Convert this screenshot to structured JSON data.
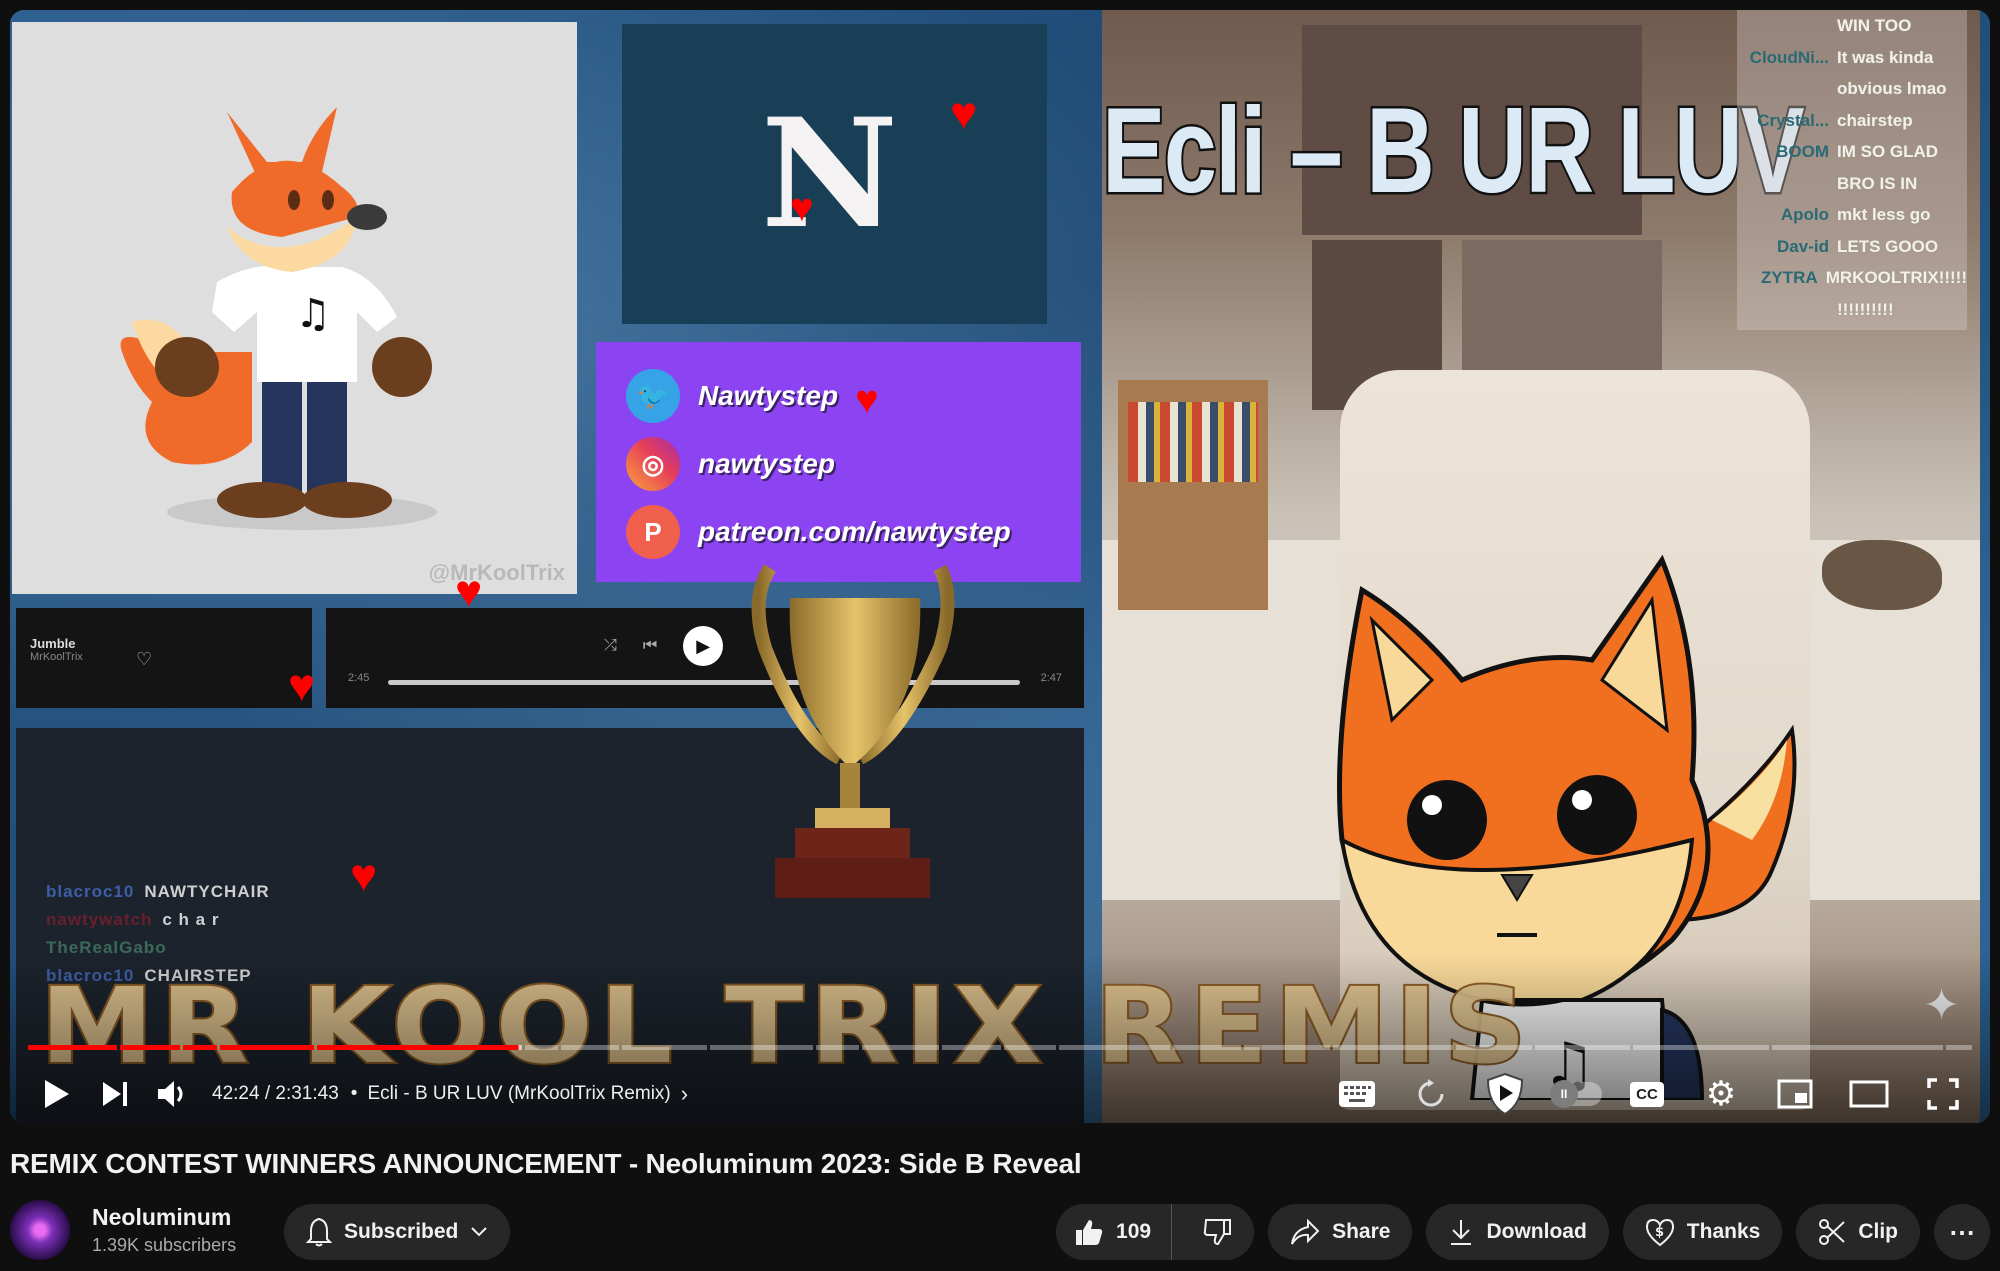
{
  "video_frame": {
    "fox_watermark": "@MrKoolTrix",
    "logo_letter": "N",
    "socials": [
      {
        "icon": "twitter-icon",
        "text": "Nawtystep"
      },
      {
        "icon": "instagram-icon",
        "text": "nawtystep"
      },
      {
        "icon": "patreon-icon",
        "text": "patreon.com/nawtystep"
      }
    ],
    "music_player": {
      "track": "Jumble",
      "artist": "MrKoolTrix",
      "time_current": "2:45",
      "time_total": "2:47"
    },
    "stream_chat_left": [
      {
        "user": "blacroc10",
        "message": "NAWTYCHAIR",
        "style": "u1"
      },
      {
        "user": "nawtywatch",
        "message": "c h a r",
        "style": "u2"
      },
      {
        "user": "TheRealGabo",
        "message": "",
        "style": "u3"
      },
      {
        "user": "blacroc10",
        "message": "CHAIRSTEP",
        "style": "u1"
      }
    ],
    "song_title_overlay": "Ecli – B UR LUV",
    "stream_chat_right": [
      {
        "user": "",
        "message": "WIN TOO"
      },
      {
        "user": "CloudNi...",
        "message": "It was kinda"
      },
      {
        "user": "",
        "message": "obvious lmao"
      },
      {
        "user": "Crystal...",
        "message": "chairstep"
      },
      {
        "user": "BOOM",
        "message": "IM SO GLAD"
      },
      {
        "user": "",
        "message": "BRO IS IN"
      },
      {
        "user": "Apolo",
        "message": "mkt less go"
      },
      {
        "user": "Dav-id",
        "message": "LETS GOOO"
      },
      {
        "user": "ZYTRA",
        "message": "MRKOOLTRIX!!!!!"
      },
      {
        "user": "",
        "message": "!!!!!!!!!!"
      }
    ],
    "banner_text": "MR KOOL TRIX REMIS"
  },
  "player": {
    "progress_fraction": 0.28,
    "buffered_fraction": 0.285,
    "time_current": "42:24",
    "time_total": "2:31:43",
    "time_display": "42:24 / 2:31:43",
    "chapter": "Ecli - B UR LUV (MrKoolTrix Remix)",
    "buttons": {
      "play": "Play",
      "next": "Next",
      "volume": "Mute",
      "keyboard": "Keyboard shortcuts",
      "replay": "Replay",
      "shield": "Ad blocker",
      "autoplay": "Autoplay",
      "captions": "CC",
      "settings": "Settings",
      "miniplayer": "Miniplayer",
      "theater": "Theater mode",
      "fullscreen": "Full screen"
    },
    "accent_color": "#ff0000"
  },
  "video": {
    "title": "REMIX CONTEST WINNERS ANNOUNCEMENT - Neoluminum 2023: Side B Reveal",
    "channel_name": "Neoluminum",
    "subscribers": "1.39K subscribers",
    "subscribe_label": "Subscribed",
    "likes": "109",
    "share_label": "Share",
    "download_label": "Download",
    "thanks_label": "Thanks",
    "clip_label": "Clip",
    "more_label": "⋯"
  }
}
